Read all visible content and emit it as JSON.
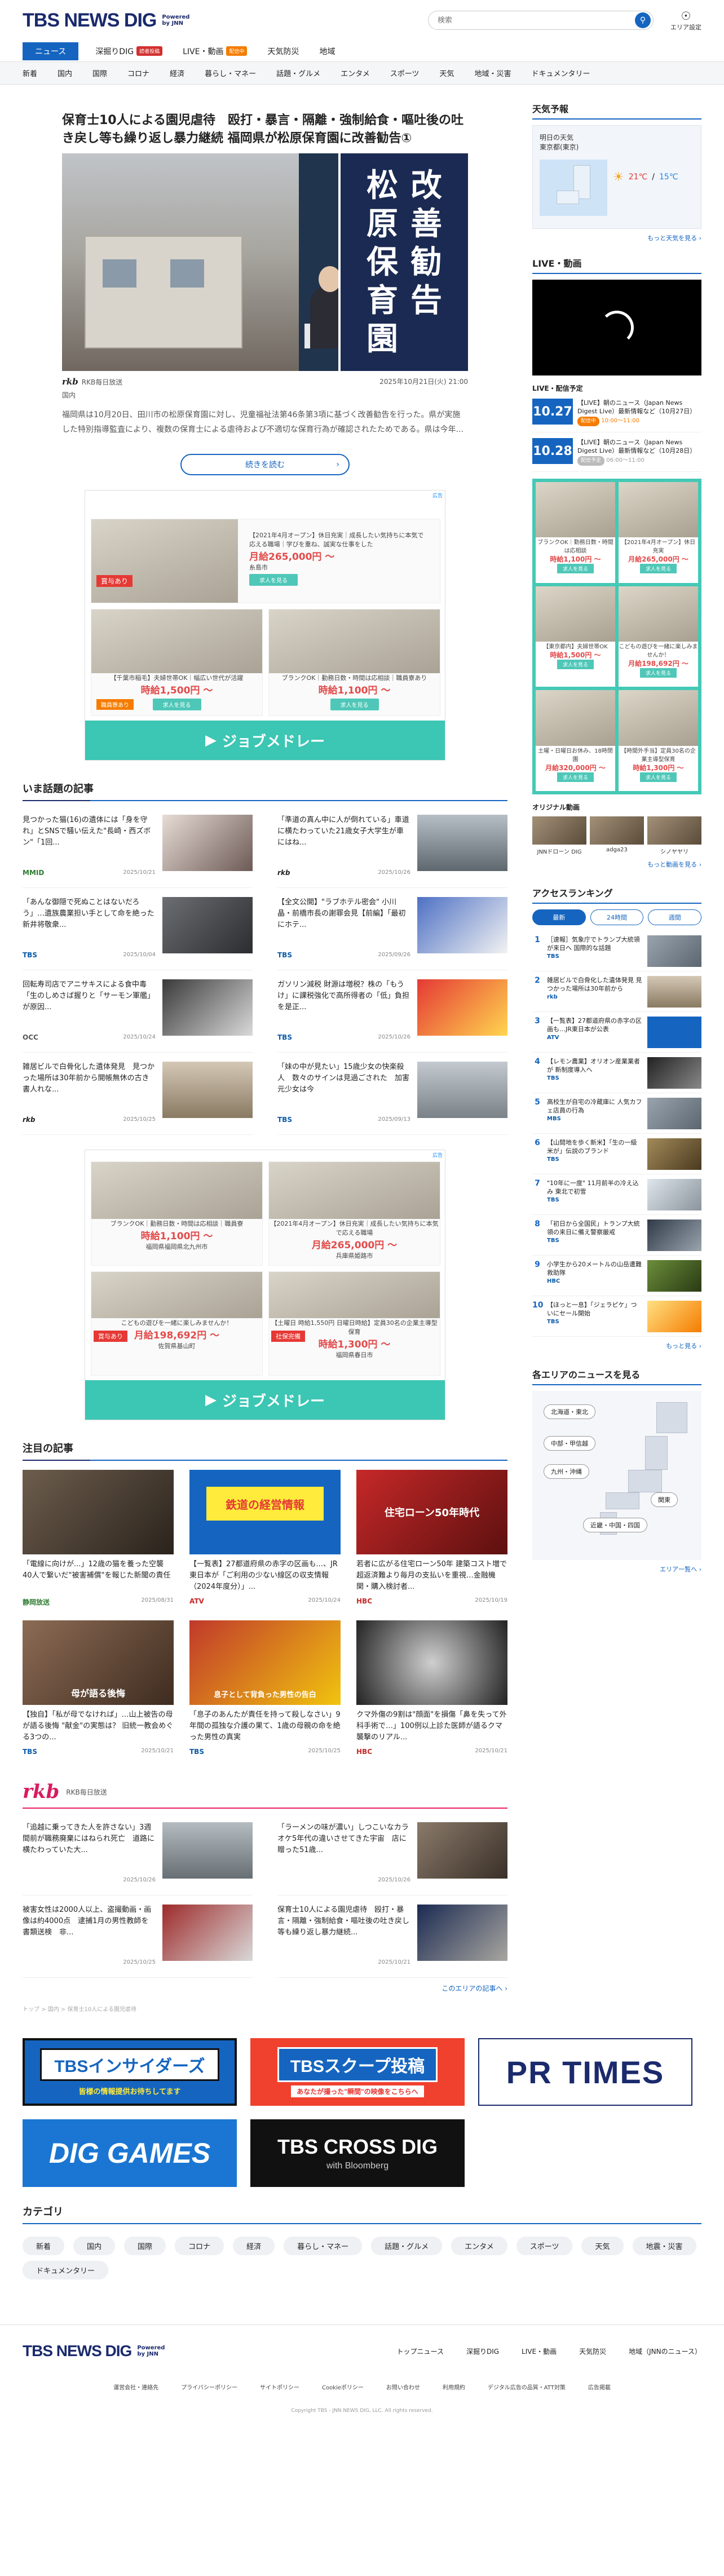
{
  "header": {
    "logo": "TBS NEWS DIG",
    "powered_line1": "Powered",
    "powered_line2": "by JNN",
    "search_placeholder": "検索",
    "area_label": "エリア設定"
  },
  "mainnav": [
    {
      "label": "ニュース",
      "active": true,
      "tag": ""
    },
    {
      "label": "深掘りDIG",
      "active": false,
      "tag": "読者投稿"
    },
    {
      "label": "LIVE・動画",
      "active": false,
      "tag": "配信中"
    },
    {
      "label": "天気防災",
      "active": false,
      "tag": ""
    },
    {
      "label": "地域",
      "active": false,
      "tag": ""
    }
  ],
  "subnav": [
    "新着",
    "国内",
    "国際",
    "コロナ",
    "経済",
    "暮らし・マネー",
    "話題・グルメ",
    "エンタメ",
    "スポーツ",
    "天気",
    "地域・災害",
    "ドキュメンタリー"
  ],
  "headline": {
    "title": "保育士10人による園児虐待　殴打・暴言・隔離・強制給食・嘔吐後の吐き戻し等も繰り返し暴力継続 福岡県が松原保育園に改善勧告①",
    "sign_col1": "松原保育園",
    "sign_col2": "改善勧告",
    "source": "RKB毎日放送",
    "datetime": "2025年10月21日(火) 21:00",
    "category": "国内",
    "summary": "福岡県は10月20日、田川市の松原保育園に対し、児童福祉法第46条第3項に基づく改善勧告を行った。県が実施した特別指導監査により、複数の保育士による虐待および不適切な保育行為が確認されたためである。県は今年...",
    "more_label": "続きを読む"
  },
  "ad1": {
    "ad_choice": "広告",
    "items": [
      {
        "text": "【2021年4月オープン】休日充実｜成長したい気持ちに本気で応える職場｜学びを重ね、誠実な仕事をした",
        "price": "月給265,000円 〜",
        "place": "糸島市",
        "btn": "求人を見る"
      },
      {
        "text": "【千葉市稲毛】夫婦世帯OK｜幅広い世代が活躍",
        "price": "時給1,500円 〜",
        "place": "千葉市",
        "btn": "求人を見る"
      },
      {
        "text": "ブランクOK｜勤務日数・時間は応相談｜職員寮あり",
        "price": "時給1,100円 〜",
        "place": "大牟田市",
        "btn": "求人を見る"
      }
    ],
    "badge": "賞与あり",
    "badge2": "職員寮あり",
    "brand": "ジョブメドレー"
  },
  "trending": {
    "title": "いま話題の記事",
    "items": [
      {
        "title": "見つかった猫(16)の遺体には「身を守れ」とSNSで騒い伝えた\"長崎・西ズボン\"「1回...",
        "source": "MMID",
        "date": "2025/10/21"
      },
      {
        "title": "「準道の真ん中に人が倒れている」車道に横たわっていた21歳女子大学生が車にはね...",
        "source": "rkb",
        "date": "2025/10/26"
      },
      {
        "title": "「あんな御隠で死ぬことはないだろう」…遺族農業担い手として命を絶った新井将敬衆...",
        "source": "TBS",
        "date": "2025/10/04"
      },
      {
        "title": "【全文公開】\"ラブホテル密会\" 小川晶・前橋市長の謝罪会見【前編】「最初にホテ...",
        "source": "TBS",
        "date": "2025/09/26"
      },
      {
        "title": "回転寿司店でアニサキスによる食中毒「生のしめさば握りと「サーモン軍艦」が原因...",
        "source": "OCC",
        "date": "2025/10/24"
      },
      {
        "title": "ガソリン減税 財源は増税？株の「もうけ」に課税強化で高所得者の「低」負担を是正...",
        "source": "TBS",
        "date": "2025/10/26"
      },
      {
        "title": "雑居ビルで白骨化した遺体発見　見つかった場所は30年前から開帳無休の古き書人れな...",
        "source": "rkb",
        "date": "2025/10/25"
      },
      {
        "title": "「妹の中が見たい」15歳少女の快楽殺人　数々のサインは見過ごされた　加害元少女は今",
        "source": "TBS",
        "date": "2025/09/13"
      }
    ]
  },
  "ad2": {
    "ad_choice": "広告",
    "items": [
      {
        "text": "ブランクOK｜勤務日数・時間は応相談｜職員寮",
        "price": "時給1,100円 〜",
        "place": "福岡県福岡県北九州市",
        "btn": "求人を見る"
      },
      {
        "text": "【2021年4月オープン】休日充実｜成長したい気持ちに本気で応える職場",
        "price": "月給265,000円 〜",
        "place": "兵庫県姫路市",
        "btn": "求人を見る"
      },
      {
        "text": "こどもの遊びを一緒に楽しみませんか！",
        "price": "月給198,692円 〜",
        "place": "佐賀県基山町",
        "btn": "求人を見る"
      },
      {
        "text": "【土曜日 時給1,550円 日曜日時給】定員30名の企業主導型保育",
        "price": "時給1,300円 〜",
        "place": "福岡県春日市",
        "btn": "求人を見る"
      }
    ],
    "badge": "賞与あり",
    "badge2": "社保完備",
    "brand": "ジョブメドレー"
  },
  "featured": {
    "title": "注目の記事",
    "items": [
      {
        "title": "「電線に向けが...」12歳の猫を養った空襲　40人で繋いだ\"被害補償\"を報じた新聞の責任",
        "source": "静岡放送",
        "date": "2025/08/31"
      },
      {
        "title": "【一覧表】27都道府県の赤字の区画も...、JR東日本が「ご利用の少ない線区の収支情報（2024年度分）」...",
        "source": "ATV",
        "date": "2025/10/24"
      },
      {
        "title": "若者に広がる住宅ローン50年 建築コスト増で超返済難より毎月の支払いを重視…金融機関・購入検討者...",
        "source": "HBC",
        "date": "2025/10/19"
      },
      {
        "title": "【独自】「私が母でなければ」…山上被告の母が語る後悔 \"献金\"の実態は？ 旧統一教会めぐる3つの...",
        "source": "TBS",
        "date": "2025/10/21"
      },
      {
        "title": "「息子のあんたが責任を持って殺しなさい」9年間の孤独な介護の果て、1歳の母親の命を絶った男性の真実",
        "source": "TBS",
        "date": "2025/10/25"
      },
      {
        "title": "クマ外傷の9割は\"顔面\"を損傷「鼻を失って外科手術で…」100例以上診た医師が語るクマ襲撃のリアル...",
        "source": "HBC",
        "date": "2025/10/21"
      }
    ],
    "badge1": "鉄道の経営情報",
    "badge2": "住宅ローン50年時代",
    "badge3": "母が語る後悔",
    "badge4": "息子として背負った男性の告白"
  },
  "rkb": {
    "logo": "rkb",
    "name": "RKB毎日放送",
    "items": [
      {
        "title": "「追越に乗ってきた人を許さない」3週間前が職務廃棄にはねられ死亡　道路に横たわっていた大...",
        "date": "2025/10/26"
      },
      {
        "title": "「ラーメンの味が濃い」しつこいなカラオケ5年代の違いさせてきた宇宙　店に贈った51歳...",
        "date": "2025/10/26"
      },
      {
        "title": "被害女性は2000人以上、盗撮動画・画像は約4000点　逮捕1月の男性教師を書類送検　非...",
        "date": "2025/10/25"
      },
      {
        "title": "保育士10人による園児虐待　殴打・暴言・隔離・強制給食・嘔吐後の吐き戻し等も繰り返し暴力継続...",
        "date": "2025/10/21"
      }
    ],
    "more": "このエリアの記事へ ›"
  },
  "right": {
    "weather_title": "天気予報",
    "weather_day": "明日の天気",
    "weather_city": "東京都(東京)",
    "weather_hi": "21℃",
    "weather_lo": "15℃",
    "weather_sep": "/",
    "weather_more": "もっと天気を見る ›",
    "live_title": "LIVE・動画",
    "live_sched_title": "LIVE・配信予定",
    "sched": [
      {
        "date": "10.27",
        "text": "【LIVE】朝のニュース（Japan News Digest Live）最新情報など（10月27日）",
        "status": "配信中",
        "time": "10:00〜11:00",
        "on": true
      },
      {
        "date": "10.28",
        "text": "【LIVE】朝のニュース（Japan News Digest Live）最新情報など（10月28日）",
        "status": "配信予定",
        "time": "06:00〜11:00",
        "on": false
      }
    ],
    "side_ad": [
      {
        "t": "ブランクOK｜勤務日数・時間は応相談",
        "p": "時給1,100円 〜",
        "btn": "求人を見る"
      },
      {
        "t": "【2021年4月オープン】休日充実",
        "p": "月給265,000円 〜",
        "btn": "求人を見る"
      },
      {
        "t": "【東京都内】夫婦世帯OK",
        "p": "時給1,500円 〜",
        "btn": "求人を見る"
      },
      {
        "t": "こどもの遊びを一緒に楽しみませんか！",
        "p": "月給198,692円 〜",
        "btn": "求人を見る"
      },
      {
        "t": "土曜・日曜日お休み、18時閉園",
        "p": "月給320,000円 〜",
        "btn": "求人を見る"
      },
      {
        "t": "【時間外手当】定員30名の企業主導型保育",
        "p": "時給1,300円 〜",
        "btn": "求人を見る"
      }
    ],
    "orig_title": "オリジナル動画",
    "orig": [
      "JNNドローン DIG",
      "adga23",
      "シノヤヤリ"
    ],
    "orig_more": "もっと動画を見る ›",
    "rank_title": "アクセスランキング",
    "rank_tabs": [
      "最新",
      "24時間",
      "週間"
    ],
    "rank": [
      {
        "t": "［速報］気象庁でトランプ大統領が来日へ 国際的な話題",
        "s": "TBS"
      },
      {
        "t": "雑居ビルで白骨化した遺体発見 見つかった場所は30年前から",
        "s": "rkb"
      },
      {
        "t": "【一覧表】27都道府県の赤字の区画も…JR東日本が公表",
        "s": "ATV"
      },
      {
        "t": "【レモン農業】オリオン産業業者が 新制度導入へ",
        "s": "TBS"
      },
      {
        "t": "高校生が自宅の冷蔵庫に 人気カフェ店員の行為",
        "s": "MBS"
      },
      {
        "t": "【山間地を歩く新米】「生の一級米が」伝説のブランド",
        "s": "TBS"
      },
      {
        "t": "\"10年に一度\" 11月前半の冷え込み 東北で初雪",
        "s": "TBS"
      },
      {
        "t": "「初日から全国民」トランプ大統領の来日に備え警察厳戒",
        "s": "TBS"
      },
      {
        "t": "小学生から20メートルの山岳遭難 救助隊",
        "s": "HBC"
      },
      {
        "t": "【ほっと一息】「ジェラピケ」ついにセール開始",
        "s": "TBS"
      }
    ],
    "rank_more": "もっと見る ›",
    "area_title": "各エリアのニュースを見る",
    "areas": [
      "北海道・東北",
      "中部・甲信越",
      "九州・沖縄",
      "関東",
      "近畿・中国・四国"
    ],
    "area_more": "エリア一覧へ ›"
  },
  "banners": {
    "insider_main": "TBSインサイダーズ",
    "insider_sub": "皆様の情報提供お待ちしてます",
    "scoop_main": "TBSスクープ投稿",
    "scoop_sub": "あなたが撮った\"瞬間\"の映像をこちらへ",
    "pr": "PR TIMES",
    "dig": "DIG GAMES",
    "cross": "TBS CROSS DIG",
    "cross_sub": "with Bloomberg"
  },
  "disclaimer": "トップ > 国内 > 保育士10人による園児虐待",
  "categories": {
    "title": "カテゴリ",
    "items": [
      "新着",
      "国内",
      "国際",
      "コロナ",
      "経済",
      "暮らし・マネー",
      "話題・グルメ",
      "エンタメ",
      "スポーツ",
      "天気",
      "地震・災害",
      "ドキュメンタリー"
    ]
  },
  "footer": {
    "logo": "TBS NEWS DIG",
    "powered_line1": "Powered",
    "powered_line2": "by JNN",
    "links": [
      "トップニュース",
      "深掘りDIG",
      "LIVE・動画",
      "天気防災",
      "地域（JNNのニュース）"
    ],
    "links2": [
      "運営会社・連絡先",
      "プライバシーポリシー",
      "サイトポリシー",
      "Cookieポリシー",
      "お問い合わせ",
      "利用規約",
      "デジタル広告の品質・ATT対策",
      "広告掲載"
    ],
    "copyright": "Copyright TBS - JNN NEWS DIG, LLC. All rights reserved."
  }
}
